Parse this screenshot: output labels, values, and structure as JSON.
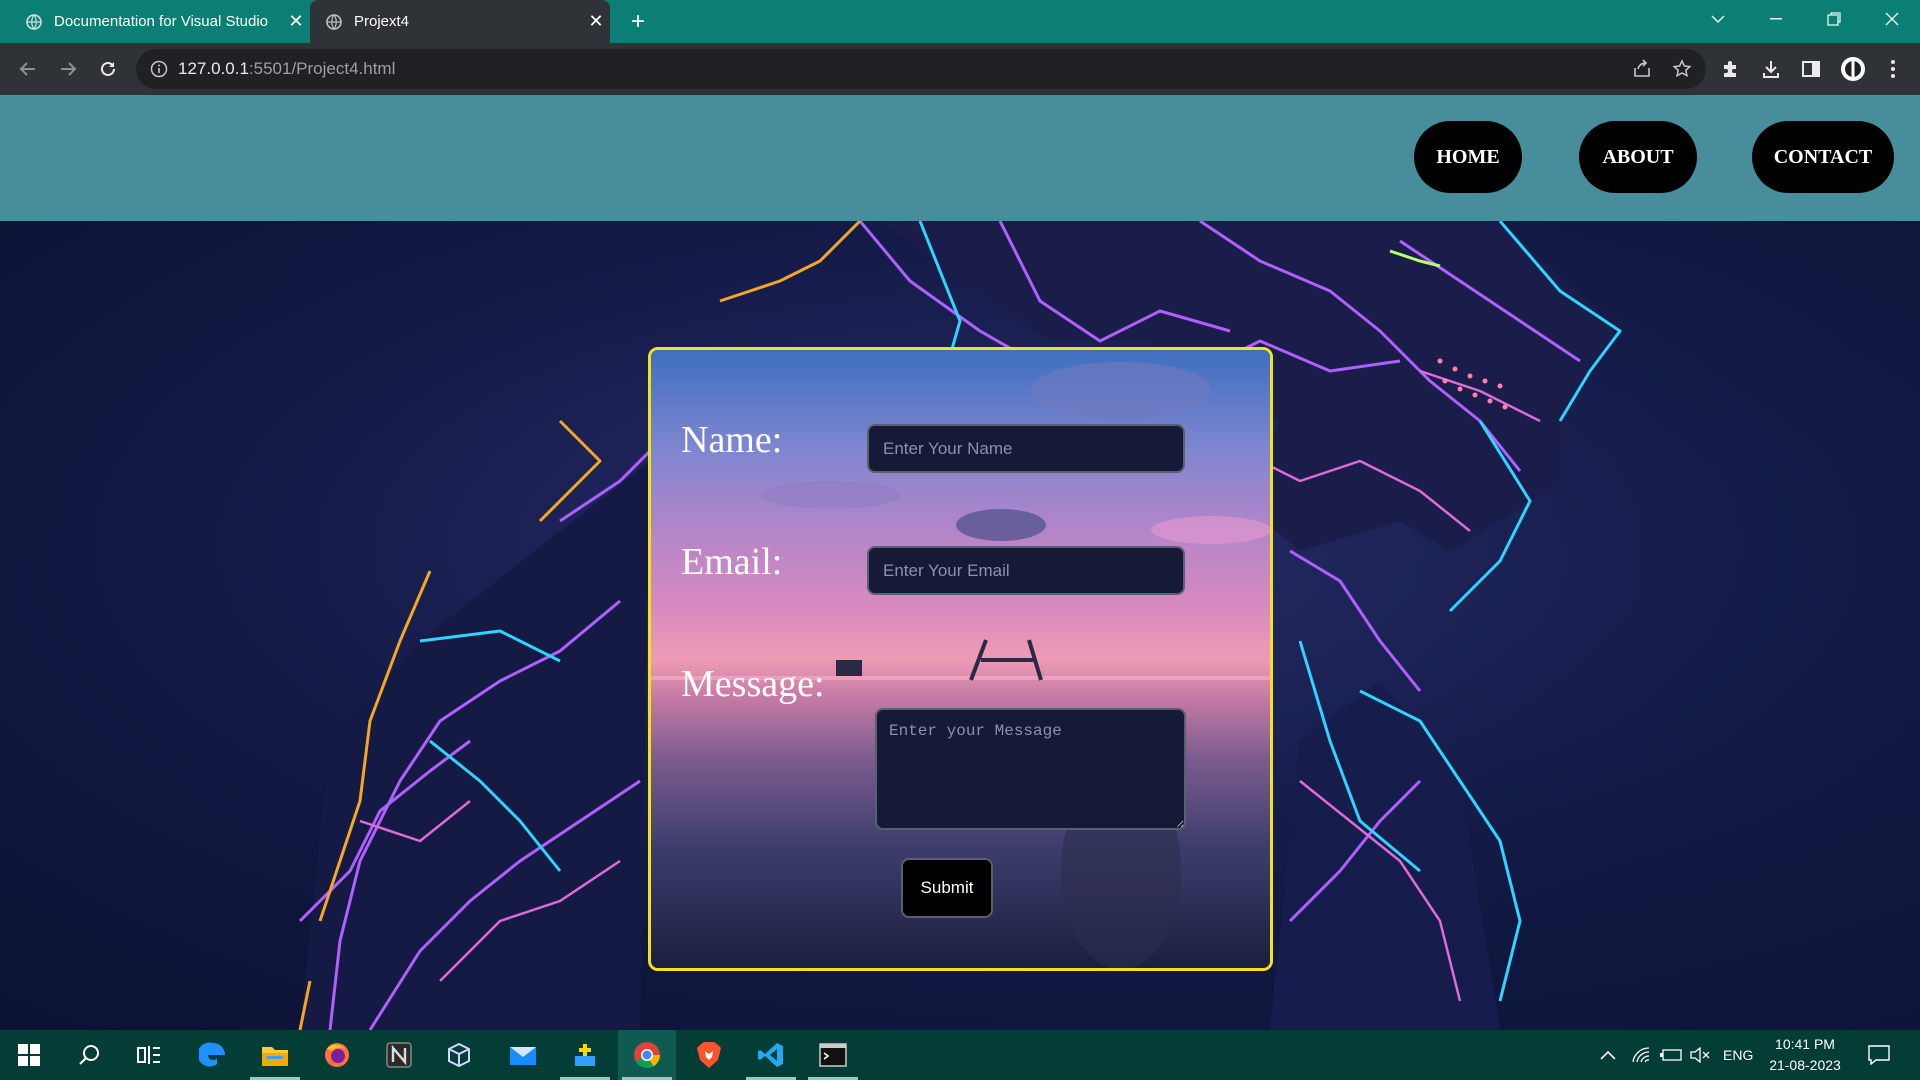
{
  "browser": {
    "tabs": [
      {
        "title": "Documentation for Visual Studio",
        "active": false
      },
      {
        "title": "Projext4",
        "active": true
      }
    ],
    "new_tab_icon": "plus-icon",
    "url_host": "127.0.0.1",
    "url_path": ":5501/Project4.html",
    "window_controls": [
      "chevron-down-icon",
      "minimize-icon",
      "restore-icon",
      "close-icon"
    ],
    "toolbar_icons": [
      "share-icon",
      "star-icon",
      "extensions-icon",
      "download-icon",
      "sidepanel-icon",
      "profile-icon",
      "menu-icon"
    ]
  },
  "page": {
    "nav": {
      "home": "HOME",
      "about": "ABOUT",
      "contact": "CONTACT"
    },
    "form": {
      "name_label": "Name:",
      "name_placeholder": "Enter Your Name",
      "email_label": "Email:",
      "email_placeholder": "Enter Your Email",
      "message_label": "Message:",
      "message_placeholder": "Enter your Message",
      "submit_label": "Submit"
    },
    "colors": {
      "navbar": "#478d9c",
      "form_border": "#f2e21c",
      "button_bg": "#000000"
    }
  },
  "taskbar": {
    "apps": [
      "windows-start-icon",
      "search-icon",
      "task-view-icon",
      "edge-icon",
      "file-explorer-icon",
      "firefox-icon",
      "notion-icon",
      "virtualbox-icon",
      "mail-icon",
      "app-icon",
      "chrome-icon",
      "brave-icon",
      "vscode-icon",
      "terminal-icon"
    ],
    "language": "ENG",
    "time": "10:41 PM",
    "date": "21-08-2023"
  }
}
